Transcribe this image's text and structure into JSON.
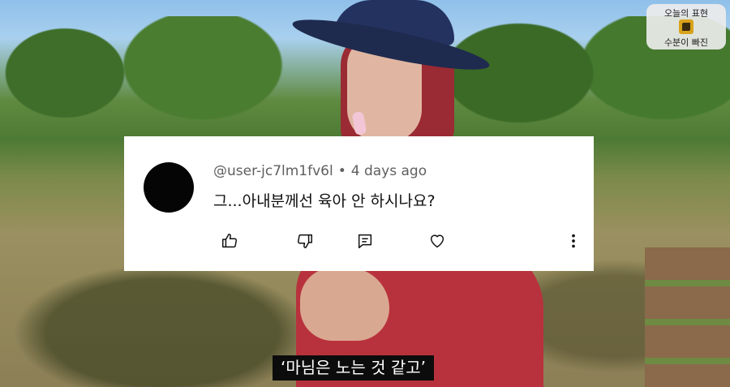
{
  "comment": {
    "username": "@user-jc7lm1fv6l",
    "separator": "•",
    "time": "4 days ago",
    "text": "그...아내분께선 육아 안 하시나요?"
  },
  "badge": {
    "line1": "오늘의 표현",
    "line2": "수분이 빠진"
  },
  "subtitle": "‘마님은 노는 것 같고’",
  "colors": {
    "card_bg": "#ffffff",
    "avatar": "#050505",
    "shirt": "#b8323d",
    "hat": "#243260"
  },
  "icons": [
    "thumbs-up-icon",
    "thumbs-down-icon",
    "reply-icon",
    "heart-icon",
    "more-vert-icon",
    "badge-icon"
  ]
}
